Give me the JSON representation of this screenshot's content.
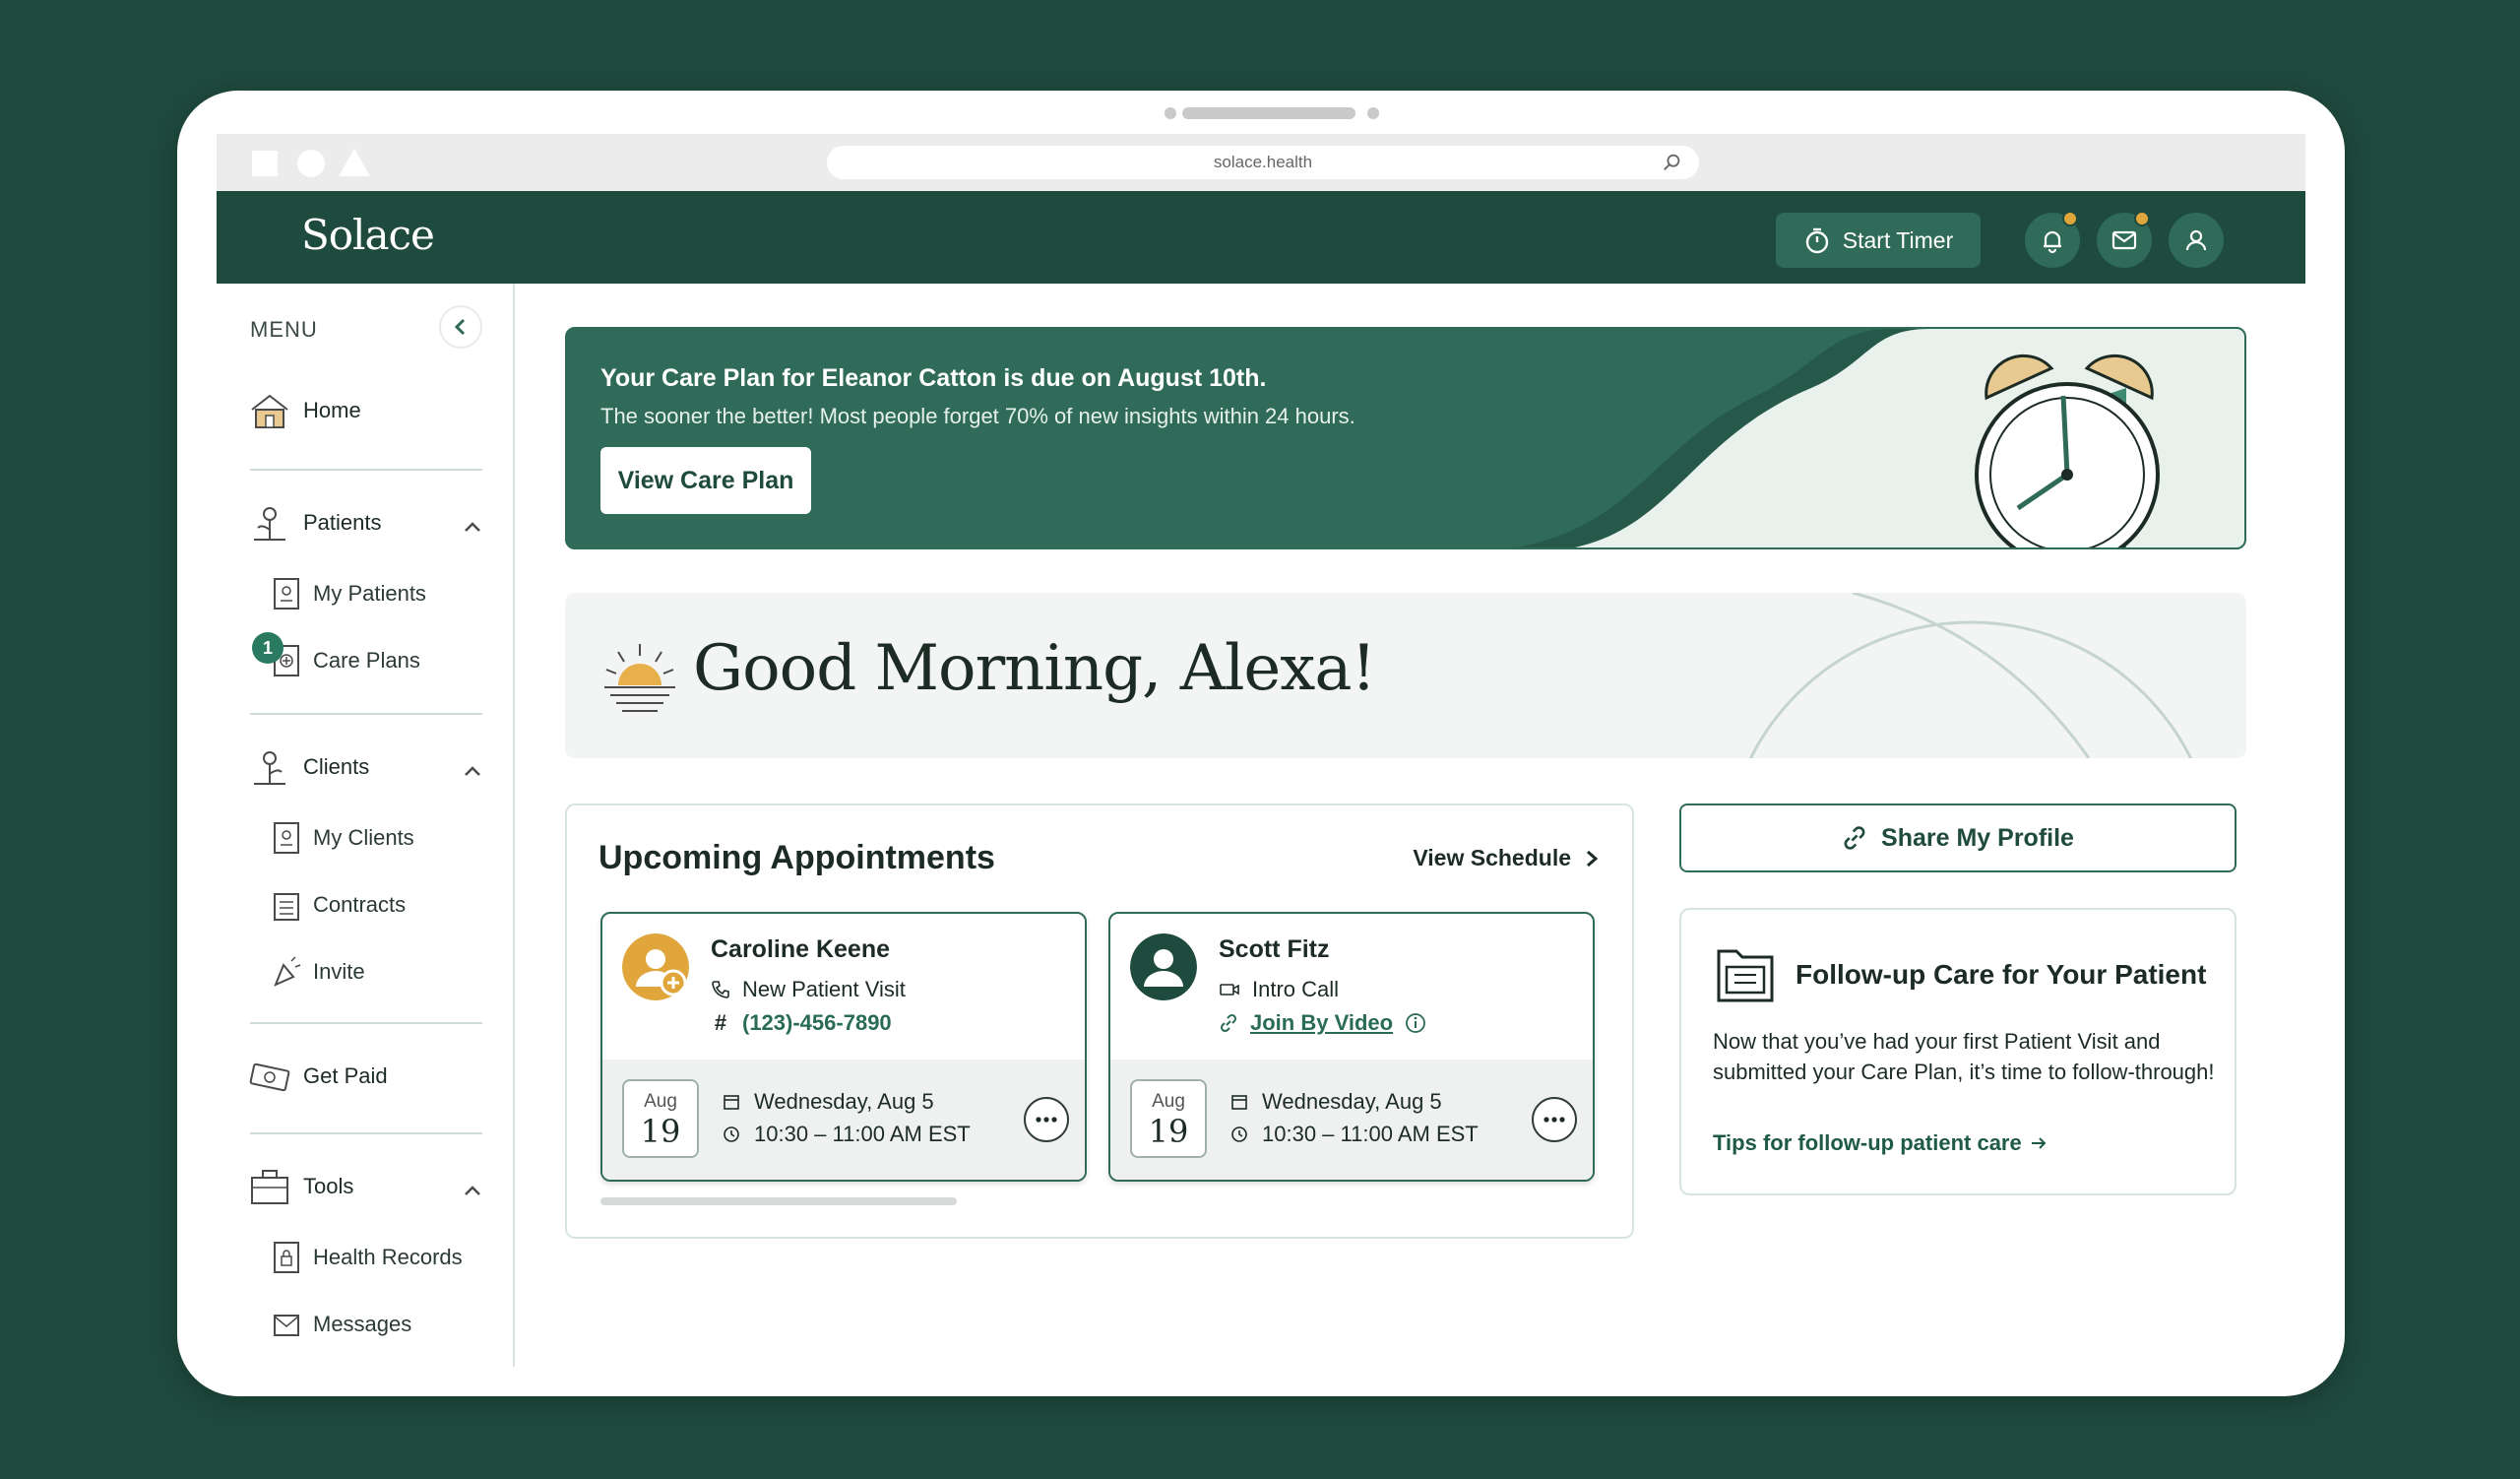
{
  "browser": {
    "url": "solace.health"
  },
  "topnav": {
    "logo": "Solace",
    "timer_label": "Start Timer"
  },
  "sidebar": {
    "menu_label": "MENU",
    "home": "Home",
    "patients": {
      "label": "Patients",
      "items": [
        "My Patients",
        "Care Plans"
      ],
      "care_plans_badge": "1"
    },
    "clients": {
      "label": "Clients",
      "items": [
        "My Clients",
        "Contracts",
        "Invite"
      ]
    },
    "get_paid": "Get Paid",
    "tools": {
      "label": "Tools",
      "items": [
        "Health Records",
        "Messages"
      ]
    }
  },
  "banner": {
    "title": "Your Care Plan for Eleanor Catton is due on August 10th.",
    "subtitle": "The sooner the better! Most people forget 70% of new insights within 24 hours.",
    "button": "View Care Plan"
  },
  "greeting": {
    "text": "Good Morning, Alexa!"
  },
  "appointments": {
    "title": "Upcoming Appointments",
    "view_schedule": "View Schedule",
    "cards": [
      {
        "name": "Caroline Keene",
        "type": "New Patient Visit",
        "contact": "(123)-456-7890",
        "date_month": "Aug",
        "date_day": "19",
        "date_full": "Wednesday, Aug 5",
        "time": "10:30 – 11:00 AM EST"
      },
      {
        "name": "Scott Fitz",
        "type": "Intro Call",
        "contact": "Join By Video",
        "date_month": "Aug",
        "date_day": "19",
        "date_full": "Wednesday, Aug 5",
        "time": "10:30 – 11:00 AM EST"
      }
    ]
  },
  "share": {
    "label": "Share My Profile"
  },
  "followup": {
    "title": "Follow-up Care for Your Patient",
    "body": "Now that you’ve had your first Patient Visit and submitted your Care Plan, it’s time to follow-through!",
    "link": "Tips for follow-up patient care"
  },
  "colors": {
    "brand": "#1f4a3e",
    "accent": "#2f6b58",
    "notification": "#e0a53b",
    "avatar_gold": "#e0a53b"
  }
}
